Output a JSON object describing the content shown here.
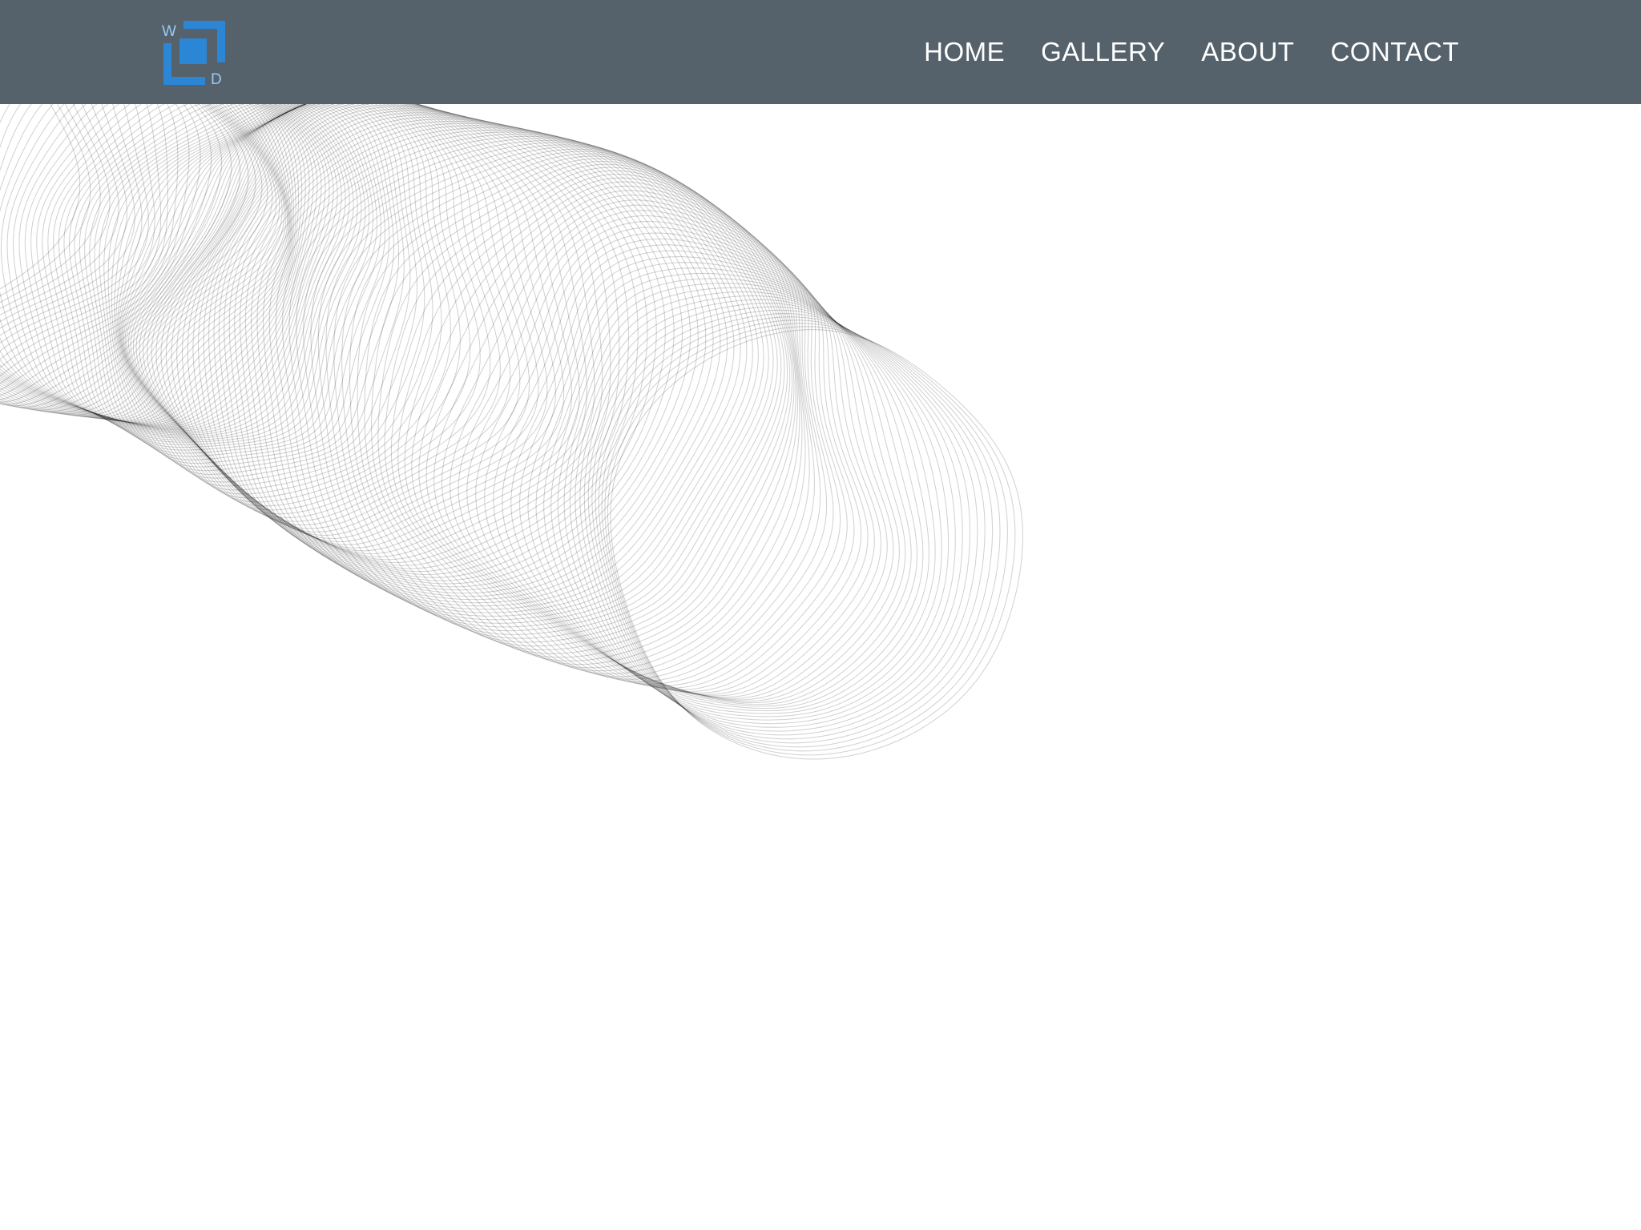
{
  "brand": {
    "logo_letter_top": "W",
    "logo_letter_bottom": "D",
    "logo_color": "#2b86d6"
  },
  "nav": {
    "items": [
      {
        "label": "HOME"
      },
      {
        "label": "GALLERY"
      },
      {
        "label": "ABOUT"
      },
      {
        "label": "CONTACT"
      }
    ]
  },
  "colors": {
    "header_bg": "#55626b",
    "nav_text": "#ffffff",
    "page_bg": "#ffffff",
    "art_line": "#111111"
  }
}
